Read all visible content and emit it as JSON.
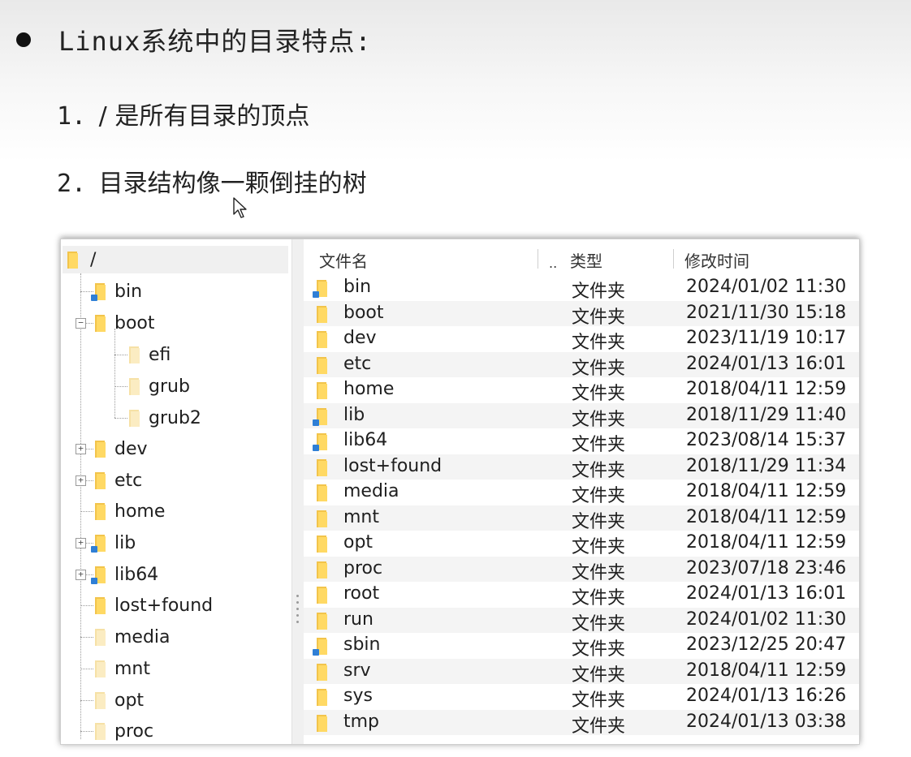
{
  "heading": "Linux系统中的目录特点:",
  "points": [
    {
      "num": "1.",
      "text": "/ 是所有目录的顶点"
    },
    {
      "num": "2.",
      "text": "目录结构像一颗倒挂的树"
    }
  ],
  "tree": {
    "root": "/",
    "items": [
      {
        "label": "bin",
        "link": true,
        "expander": ""
      },
      {
        "label": "boot",
        "link": false,
        "expander": "⊟"
      },
      {
        "label": "efi",
        "link": false,
        "expander": ""
      },
      {
        "label": "grub",
        "link": false,
        "expander": ""
      },
      {
        "label": "grub2",
        "link": false,
        "expander": ""
      },
      {
        "label": "dev",
        "link": false,
        "expander": "⊞"
      },
      {
        "label": "etc",
        "link": false,
        "expander": "⊞"
      },
      {
        "label": "home",
        "link": false,
        "expander": ""
      },
      {
        "label": "lib",
        "link": true,
        "expander": "⊞"
      },
      {
        "label": "lib64",
        "link": true,
        "expander": "⊞"
      },
      {
        "label": "lost+found",
        "link": false,
        "expander": ""
      },
      {
        "label": "media",
        "link": false,
        "expander": ""
      },
      {
        "label": "mnt",
        "link": false,
        "expander": ""
      },
      {
        "label": "opt",
        "link": false,
        "expander": ""
      },
      {
        "label": "proc",
        "link": false,
        "expander": ""
      }
    ]
  },
  "columns": {
    "name": "文件名",
    "sort": "..",
    "type": "类型",
    "modified": "修改时间"
  },
  "files": [
    {
      "name": "bin",
      "type": "文件夹",
      "modified": "2024/01/02 11:30",
      "link": true
    },
    {
      "name": "boot",
      "type": "文件夹",
      "modified": "2021/11/30 15:18",
      "link": false
    },
    {
      "name": "dev",
      "type": "文件夹",
      "modified": "2023/11/19 10:17",
      "link": false
    },
    {
      "name": "etc",
      "type": "文件夹",
      "modified": "2024/01/13 16:01",
      "link": false
    },
    {
      "name": "home",
      "type": "文件夹",
      "modified": "2018/04/11 12:59",
      "link": false
    },
    {
      "name": "lib",
      "type": "文件夹",
      "modified": "2018/11/29 11:40",
      "link": true
    },
    {
      "name": "lib64",
      "type": "文件夹",
      "modified": "2023/08/14 15:37",
      "link": true
    },
    {
      "name": "lost+found",
      "type": "文件夹",
      "modified": "2018/11/29 11:34",
      "link": false
    },
    {
      "name": "media",
      "type": "文件夹",
      "modified": "2018/04/11 12:59",
      "link": false
    },
    {
      "name": "mnt",
      "type": "文件夹",
      "modified": "2018/04/11 12:59",
      "link": false
    },
    {
      "name": "opt",
      "type": "文件夹",
      "modified": "2018/04/11 12:59",
      "link": false
    },
    {
      "name": "proc",
      "type": "文件夹",
      "modified": "2023/07/18 23:46",
      "link": false
    },
    {
      "name": "root",
      "type": "文件夹",
      "modified": "2024/01/13 16:01",
      "link": false
    },
    {
      "name": "run",
      "type": "文件夹",
      "modified": "2024/01/02 11:30",
      "link": false
    },
    {
      "name": "sbin",
      "type": "文件夹",
      "modified": "2023/12/25 20:47",
      "link": true
    },
    {
      "name": "srv",
      "type": "文件夹",
      "modified": "2018/04/11 12:59",
      "link": false
    },
    {
      "name": "sys",
      "type": "文件夹",
      "modified": "2024/01/13 16:26",
      "link": false
    },
    {
      "name": "tmp",
      "type": "文件夹",
      "modified": "2024/01/13 03:38",
      "link": false
    }
  ]
}
